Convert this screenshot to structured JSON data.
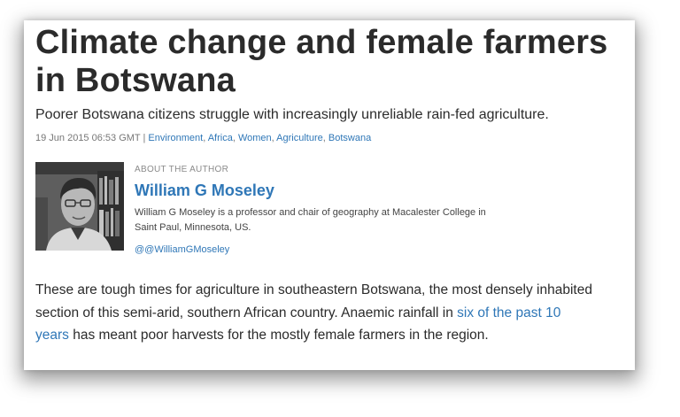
{
  "article": {
    "headline": "Climate change and female farmers in Botswana",
    "standfirst": "Poorer Botswana citizens struggle with increasingly unreliable rain-fed agriculture.",
    "dateline": "19 Jun 2015 06:53 GMT",
    "separator": " | ",
    "tags": [
      "Environment",
      "Africa",
      "Women",
      "Agriculture",
      "Botswana"
    ]
  },
  "author": {
    "section_label": "ABOUT THE AUTHOR",
    "name": "William G Moseley",
    "bio": "William G Moseley is a professor and chair of geography at Macalester College in Saint Paul, Minnesota, US.",
    "handle": "@@WilliamGMoseley"
  },
  "body": {
    "para1_before": "These are tough times for agriculture in southeastern Botswana, the most densely inhabited section of this semi-arid, southern African country. Anaemic rainfall in ",
    "para1_link": "six of the past 10 years",
    "para1_after": " has meant poor harvests for the mostly female farmers in the region."
  },
  "colors": {
    "link": "#2f77b7",
    "text": "#2b2b2b",
    "muted": "#777777"
  }
}
